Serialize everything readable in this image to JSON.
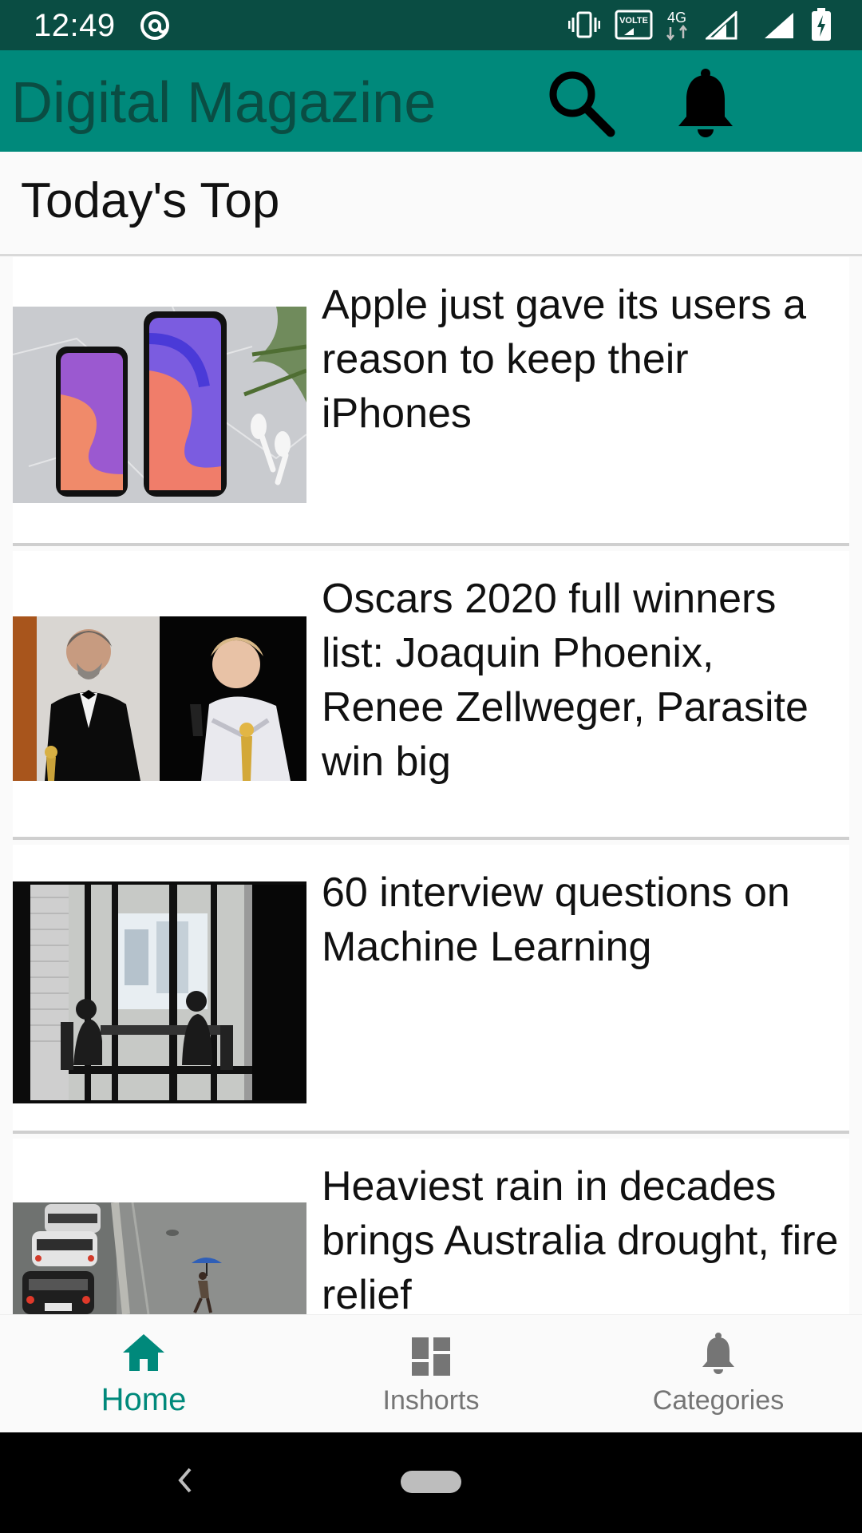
{
  "status_bar": {
    "time": "12:49",
    "left_icon": "at-sign-icon",
    "right_icons": [
      "vibrate-icon",
      "volte-icon",
      "4g-icon",
      "signal-icon",
      "signal-icon",
      "battery-charging-icon"
    ],
    "volte_label": "VOLTE",
    "network_label": "4G"
  },
  "app_bar": {
    "title": "Digital Magazine",
    "actions": [
      "search-icon",
      "bell-icon"
    ]
  },
  "section": {
    "title": "Today's Top"
  },
  "articles": [
    {
      "title": "Apple just gave its users a reason to keep their iPhones",
      "image": "iphones-on-marble"
    },
    {
      "title": "Oscars 2020 full winners list: Joaquin Phoenix, Renee Zellweger, Parasite win big",
      "image": "oscar-winners"
    },
    {
      "title": "60 interview questions on Machine Learning",
      "image": "office-meeting-silhouettes"
    },
    {
      "title": "Heaviest rain in decades brings Australia drought, fire relief",
      "image": "rainy-street"
    }
  ],
  "bottom_nav": {
    "items": [
      {
        "label": "Home",
        "icon": "home-icon",
        "active": true
      },
      {
        "label": "Inshorts",
        "icon": "dashboard-icon",
        "active": false
      },
      {
        "label": "Categories",
        "icon": "bell-icon",
        "active": false
      }
    ]
  },
  "colors": {
    "status_bar": "#0a4d43",
    "primary": "#00897b",
    "title_text": "#0a4d43",
    "inactive": "#757575"
  },
  "system_nav": {
    "icons": [
      "back-icon",
      "home-pill"
    ]
  }
}
